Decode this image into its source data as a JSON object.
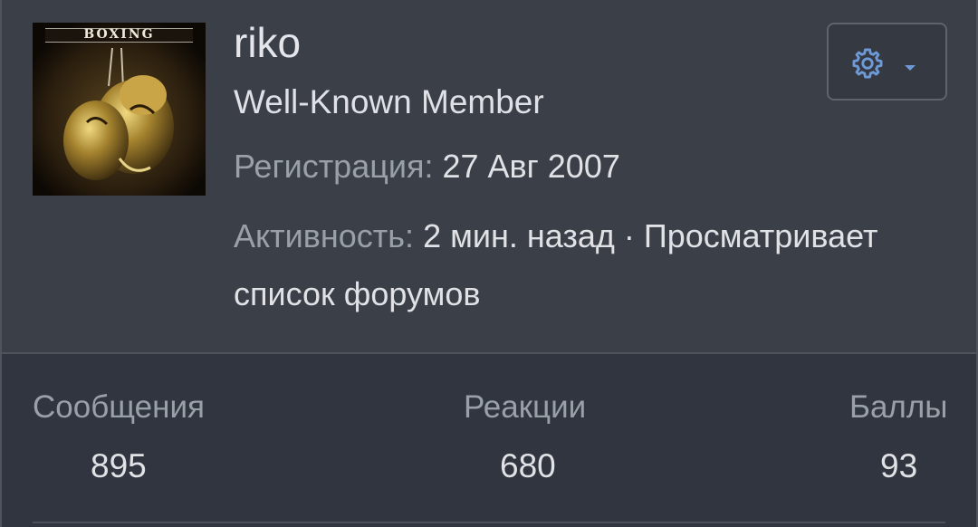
{
  "profile": {
    "username": "riko",
    "role": "Well-Known Member",
    "avatar_text": "BOXING",
    "registration_label": "Регистрация:",
    "registration_value": "27 Авг 2007",
    "activity_label": "Активность:",
    "activity_value": "2 мин. назад · Просматривает список форумов"
  },
  "settings_button": {
    "icon": "gear-icon",
    "dropdown_icon": "caret-down-icon",
    "accent_color": "#6f9ad8"
  },
  "stats": {
    "messages": {
      "label": "Сообщения",
      "value": "895"
    },
    "reactions": {
      "label": "Реакции",
      "value": "680"
    },
    "points": {
      "label": "Баллы",
      "value": "93"
    }
  }
}
